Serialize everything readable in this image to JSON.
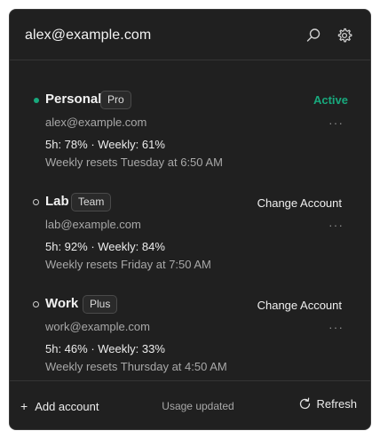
{
  "header": {
    "title": "alex@example.com",
    "search_icon": "search-icon",
    "settings_icon": "gear-icon"
  },
  "accounts": [
    {
      "name": "Personal",
      "badge": "Pro",
      "email": "alex@example.com",
      "usage": "5h: 78% · Weekly: 61%",
      "resets": "Weekly resets Tuesday at 6:50 AM",
      "status_label": "Active",
      "active": true
    },
    {
      "name": "Lab",
      "badge": "Team",
      "email": "lab@example.com",
      "usage": "5h: 92% · Weekly: 84%",
      "resets": "Weekly resets Friday at 7:50 AM",
      "action_label": "Change Account",
      "active": false
    },
    {
      "name": "Work",
      "badge": "Plus",
      "email": "work@example.com",
      "usage": "5h: 46% · Weekly: 33%",
      "resets": "Weekly resets Thursday at 4:50 AM",
      "action_label": "Change Account",
      "active": false
    }
  ],
  "more_label": "···",
  "footer": {
    "add_symbol": "+",
    "add_label": "Add account",
    "status": "Usage updated",
    "refresh_label": "Refresh"
  },
  "colors": {
    "accent": "#18a97d",
    "background": "#202020"
  }
}
